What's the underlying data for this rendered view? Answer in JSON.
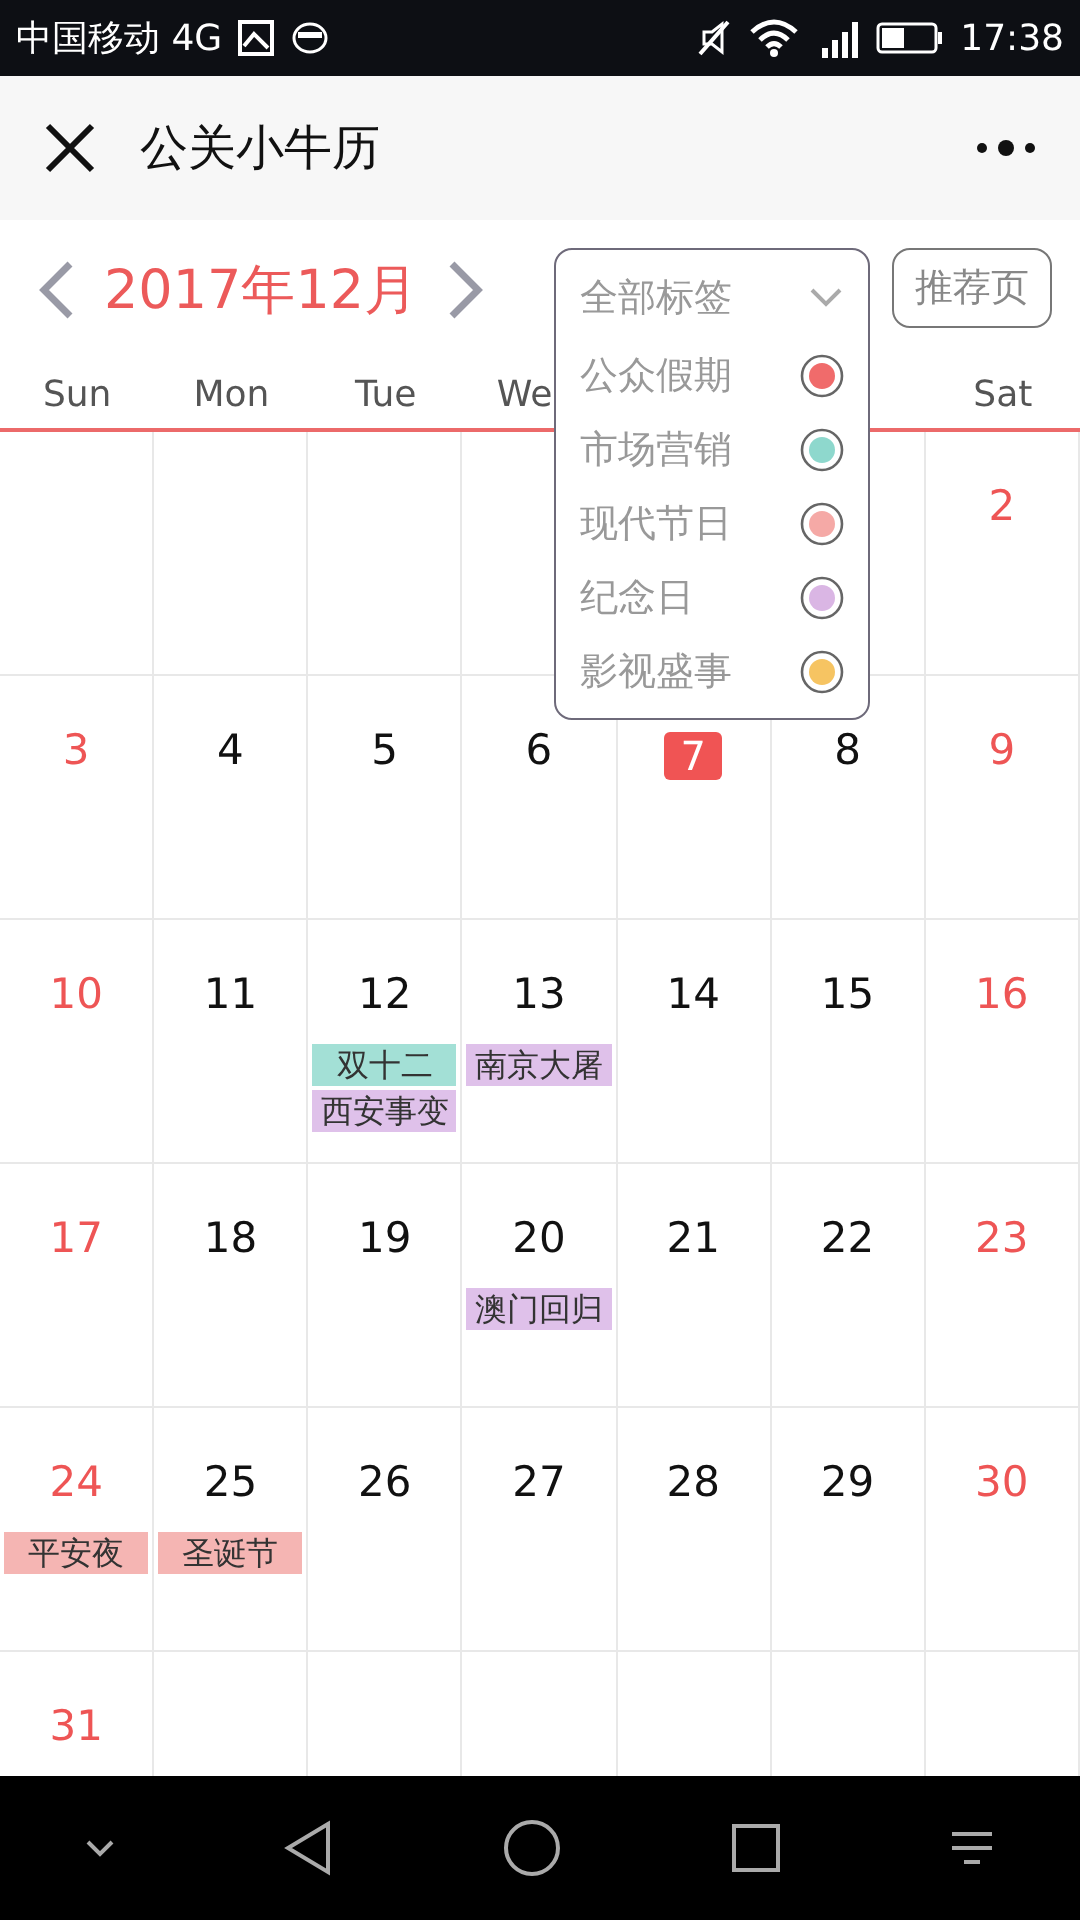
{
  "status_bar": {
    "carrier": "中国移动 4G",
    "time": "17:38"
  },
  "app_bar": {
    "title": "公关小牛历"
  },
  "month_nav": {
    "month": "2017年12月",
    "recommend_button": "推荐页"
  },
  "tag_filter": {
    "label": "全部标签",
    "expanded": true,
    "tags": [
      {
        "label": "公众假期",
        "color": "#f06b6b"
      },
      {
        "label": "市场营销",
        "color": "#8ed8cd"
      },
      {
        "label": "现代节日",
        "color": "#f5a9a6"
      },
      {
        "label": "纪念日",
        "color": "#dab6e4"
      },
      {
        "label": "影视盛事",
        "color": "#f6c462"
      }
    ]
  },
  "weekdays_left": [
    {
      "label": "Sun"
    },
    {
      "label": "Mon"
    },
    {
      "label": "Tue"
    },
    {
      "label": "We",
      "cut": true
    }
  ],
  "weekdays_right": [
    {
      "label": "Sat"
    }
  ],
  "weeks": [
    [
      {
        "day": "2"
      }
    ],
    [
      {
        "day": "3"
      },
      {
        "day": "4"
      },
      {
        "day": "5"
      },
      {
        "day": "6"
      },
      {
        "day": "7",
        "today": true
      },
      {
        "day": "8"
      },
      {
        "day": "9"
      }
    ],
    [
      {
        "day": "10"
      },
      {
        "day": "11"
      },
      {
        "day": "12",
        "events": [
          {
            "label": "双十二",
            "color": "#a3e0d6"
          },
          {
            "label": "西安事变",
            "color": "#dfc1ea"
          }
        ]
      },
      {
        "day": "13",
        "events": [
          {
            "label": "南京大屠",
            "color": "#dfc1ea"
          }
        ]
      },
      {
        "day": "14"
      },
      {
        "day": "15"
      },
      {
        "day": "16"
      }
    ],
    [
      {
        "day": "17"
      },
      {
        "day": "18"
      },
      {
        "day": "19"
      },
      {
        "day": "20",
        "events": [
          {
            "label": "澳门回归",
            "color": "#dfc1ea"
          }
        ]
      },
      {
        "day": "21"
      },
      {
        "day": "22"
      },
      {
        "day": "23"
      }
    ],
    [
      {
        "day": "24",
        "events": [
          {
            "label": "平安夜",
            "color": "#f5b5b3"
          }
        ]
      },
      {
        "day": "25",
        "events": [
          {
            "label": "圣诞节",
            "color": "#f5b5b3"
          }
        ]
      },
      {
        "day": "26"
      },
      {
        "day": "27"
      },
      {
        "day": "28"
      },
      {
        "day": "29"
      },
      {
        "day": "30"
      }
    ],
    [
      {
        "day": "31"
      }
    ]
  ]
}
